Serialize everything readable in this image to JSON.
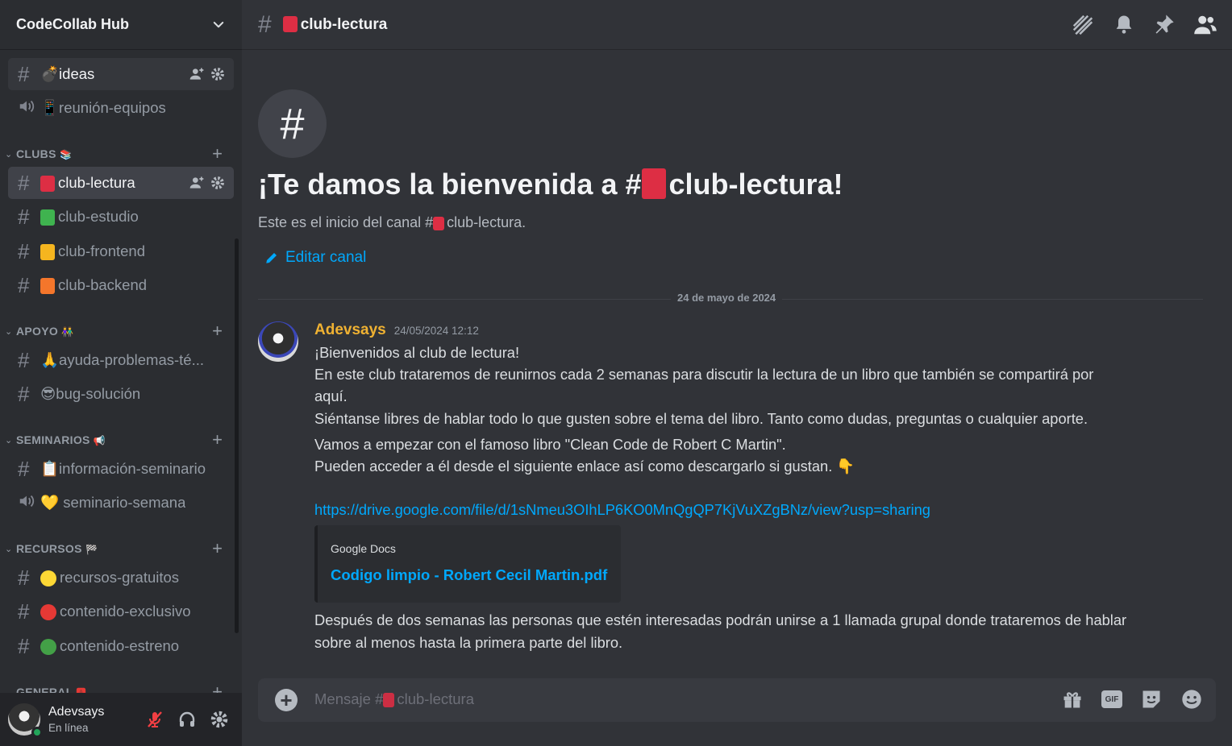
{
  "server": {
    "name": "CodeCollab Hub"
  },
  "sidebar": {
    "top_channels": [
      {
        "name": "ideas",
        "emoji": "💣",
        "type": "text"
      },
      {
        "name": "reunión-equipos",
        "emoji": "📱",
        "type": "voice"
      }
    ],
    "categories": [
      {
        "label": "CLUBS",
        "emoji": "📚",
        "channels": [
          {
            "name": "club-lectura",
            "emoji": "📕",
            "type": "text",
            "active": true
          },
          {
            "name": "club-estudio",
            "emoji": "📗",
            "type": "text"
          },
          {
            "name": "club-frontend",
            "emoji": "📒",
            "type": "text"
          },
          {
            "name": "club-backend",
            "emoji": "📙",
            "type": "text"
          }
        ]
      },
      {
        "label": "APOYO",
        "emoji": "👫",
        "channels": [
          {
            "name": "ayuda-problemas-té...",
            "emoji": "🙏",
            "type": "text"
          },
          {
            "name": "bug-solución",
            "emoji": "😎",
            "type": "text"
          }
        ]
      },
      {
        "label": "SEMINARIOS",
        "emoji": "📢",
        "channels": [
          {
            "name": "información-seminario",
            "emoji": "📋",
            "type": "text"
          },
          {
            "name": "seminario-semana",
            "emoji": "💛",
            "type": "voice"
          }
        ]
      },
      {
        "label": "RECURSOS",
        "emoji": "🏁",
        "channels": [
          {
            "name": "recursos-gratuitos",
            "emoji": "🟡",
            "type": "text"
          },
          {
            "name": "contenido-exclusivo",
            "emoji": "🔴",
            "type": "text"
          },
          {
            "name": "contenido-estreno",
            "emoji": "🟢",
            "type": "text"
          }
        ]
      },
      {
        "label": "GENERAL",
        "emoji": "🅰",
        "channels": []
      }
    ],
    "plus": "+"
  },
  "user": {
    "name": "Adevsays",
    "status": "En línea"
  },
  "topbar": {
    "hash": "#",
    "title": "club-lectura"
  },
  "welcome": {
    "icon": "#",
    "title_pre": "¡Te damos la bienvenida a #",
    "title_channel": "club-lectura!",
    "subtitle_pre": "Este es el inicio del canal #",
    "subtitle_channel": "club-lectura.",
    "edit_label": "Editar canal"
  },
  "divider": {
    "date": "24 de mayo de 2024"
  },
  "message": {
    "author": "Adevsays",
    "timestamp": "24/05/2024 12:12",
    "lines": [
      "¡Bienvenidos al club de lectura!",
      "En este club trataremos de reunirnos cada 2 semanas para discutir la lectura de un libro que también se compartirá por",
      "aquí.",
      "Siéntanse libres de hablar todo lo que gusten sobre el tema del libro. Tanto como dudas, preguntas o cualquier aporte.",
      "Vamos a empezar con el famoso libro \"Clean Code de Robert C Martin\".",
      "Pueden acceder a él desde el siguiente enlace así como descargarlo si gustan. 👇"
    ],
    "link": "https://drive.google.com/file/d/1sNmeu3OIhLP6KO0MnQgQP7KjVuXZgBNz/view?usp=sharing",
    "embed": {
      "provider": "Google Docs",
      "title": "Codigo limpio - Robert Cecil Martin.pdf"
    },
    "after_lines": [
      "Después de dos semanas las personas que estén interesadas podrán unirse a 1 llamada grupal donde trataremos de hablar",
      "sobre al menos hasta la primera parte del libro."
    ]
  },
  "composer": {
    "placeholder_pre": "Mensaje #",
    "placeholder_channel": "club-lectura",
    "gif": "GIF"
  },
  "colors": {
    "accent_link": "#00a8fc",
    "author": "#f0b232",
    "online": "#23a55a",
    "mute_red": "#f23f43"
  }
}
